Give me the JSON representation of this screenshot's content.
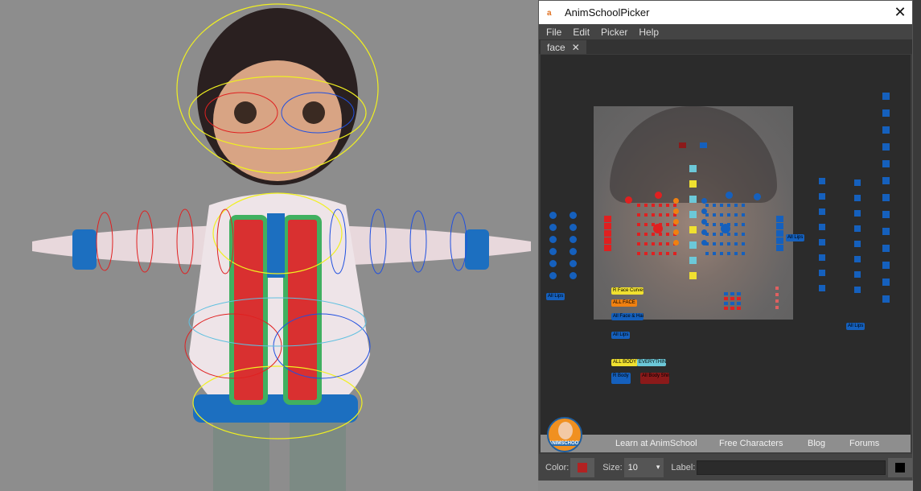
{
  "window": {
    "title": "AnimSchoolPicker",
    "close_icon": "close-icon"
  },
  "menu": [
    "File",
    "Edit",
    "Picker",
    "Help"
  ],
  "tabs": [
    {
      "label": "face",
      "close": "✕"
    }
  ],
  "canvas_labels": [
    "R Face Curves",
    "ALL FACE",
    "All Face & Hair",
    "All Lips",
    "All Lips",
    "All Lips",
    "ALL BODY",
    "EVERYTHING",
    "R Body",
    "All Body Shirt",
    "All Lips"
  ],
  "links": [
    "Learn at AnimSchool",
    "Free Characters",
    "Blog",
    "Forums"
  ],
  "logo_text": "ANIMSCHOOL",
  "bottom": {
    "color_label": "Color:",
    "color_value": "#b22222",
    "size_label": "Size:",
    "size_value": "10",
    "label_label": "Label:",
    "label_value": "",
    "bg_color": "#000000"
  },
  "colors": {
    "red": "#e02020",
    "blue": "#1560bd",
    "yellow": "#f0e030",
    "orange": "#f08010",
    "cyan": "#6cc8d8",
    "darkred": "#8b1a1a"
  }
}
